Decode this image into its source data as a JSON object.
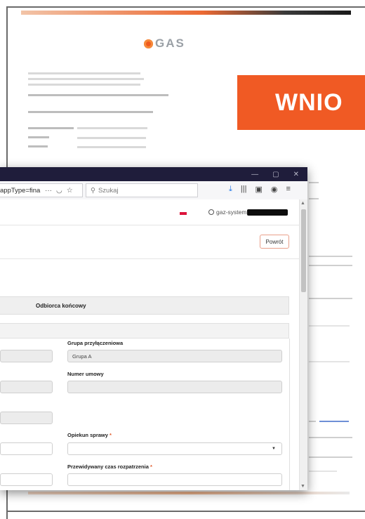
{
  "document": {
    "banner_text": "WNIO",
    "colors": {
      "accent": "#f05a24",
      "frame": "#6a6a6a"
    }
  },
  "browser": {
    "url_text": "appType=fina",
    "url_more": "···",
    "search_placeholder": "Szukaj",
    "title_controls": [
      "—",
      "▢",
      "✕"
    ]
  },
  "app": {
    "user_label": "gaz-system",
    "back_button": "Powrót",
    "tab_label": "Odbiorca końcowy",
    "form": {
      "group_label": "Grupa przyłączeniowa",
      "group_value": "Grupa A",
      "contract_label": "Numer umowy",
      "contract_value": "",
      "caretaker_label": "Opiekun sprawy",
      "caretaker_required": "*",
      "caretaker_value": "",
      "time_label": "Przewidywany czas rozpatrzenia",
      "time_required": "*"
    }
  }
}
